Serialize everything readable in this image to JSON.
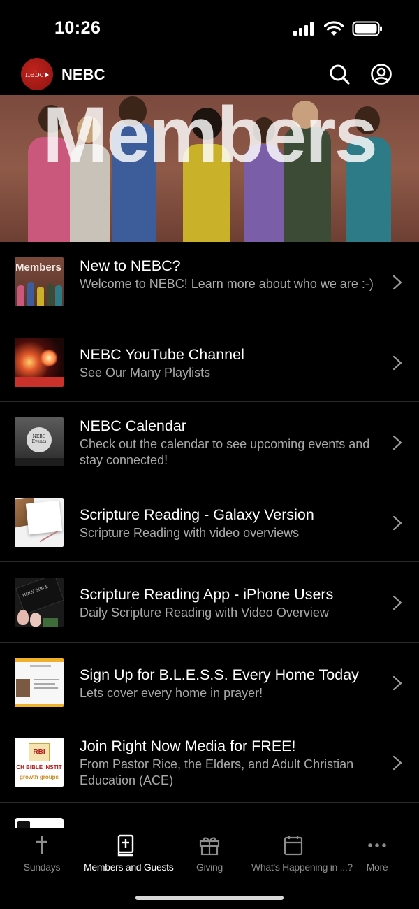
{
  "status": {
    "time": "10:26"
  },
  "header": {
    "logo_text": "nebc",
    "title": "NEBC"
  },
  "banner": {
    "title": "Members"
  },
  "list": {
    "items": [
      {
        "title": "New to NEBC?",
        "subtitle": "Welcome to NEBC!  Learn more about who we are :-)",
        "thumb_label": "Members"
      },
      {
        "title": "NEBC YouTube Channel",
        "subtitle": "See Our Many Playlists"
      },
      {
        "title": "NEBC Calendar",
        "subtitle": "Check out the calendar to see upcoming events and stay connected!",
        "thumb_label": "NEBC Events"
      },
      {
        "title": "Scripture Reading - Galaxy Version",
        "subtitle": "Scripture Reading with video overviews"
      },
      {
        "title": "Scripture Reading App - iPhone Users",
        "subtitle": "Daily Scripture Reading with Video Overview",
        "thumb_label": "HOLY BIBLE"
      },
      {
        "title": "Sign Up for B.L.E.S.S. Every Home Today",
        "subtitle": "Lets cover every home in prayer!"
      },
      {
        "title": "Join Right Now Media for FREE!",
        "subtitle": "From Pastor Rice, the Elders, and Adult Christian Education (ACE)",
        "thumb_label": "RBI",
        "thumb_label2": "CH BIBLE INSTIT",
        "thumb_label3": "growth groups"
      }
    ]
  },
  "tabs": [
    {
      "label": "Sundays",
      "icon": "cross-icon",
      "active": false
    },
    {
      "label": "Members and Guests",
      "icon": "bible-icon",
      "active": true
    },
    {
      "label": "Giving",
      "icon": "gift-icon",
      "active": false
    },
    {
      "label": "What's Happening in ...?",
      "icon": "calendar-icon",
      "active": false
    },
    {
      "label": "More",
      "icon": "more-icon",
      "active": false
    }
  ]
}
